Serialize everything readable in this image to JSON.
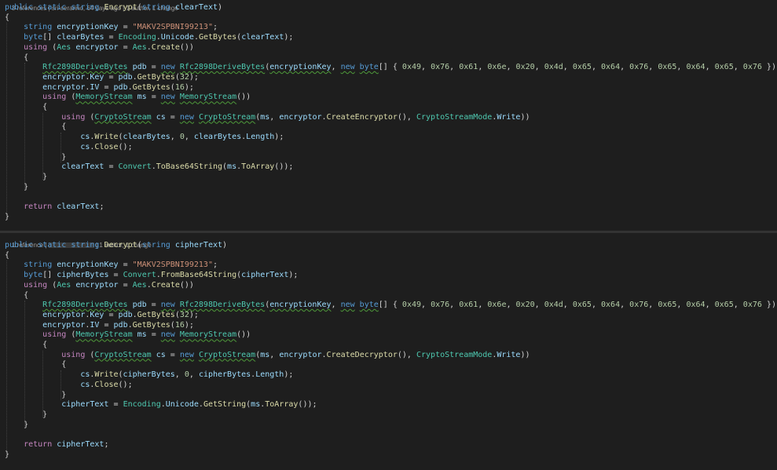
{
  "theme": {
    "background": "#1e1e1e",
    "keyword": "#569cd6",
    "type": "#4ec9b0",
    "method": "#dcdcaa",
    "variable": "#9cdcfe",
    "string": "#ce9178",
    "number": "#b5cea8",
    "control": "#c586c0",
    "plain": "#d4d4d4"
  },
  "code_lens": {
    "encrypt": "3 references | sri-serarino, 64 days ago | 1 author, 1 change",
    "decrypt_refs": "1 reference | ",
    "decrypt_meta": " | 1 author, 1 change"
  },
  "encrypt_block": [
    "public static string Encrypt(string clearText)",
    "{",
    "    string encryptionKey = \"MAKV2SPBNI99213\";",
    "    byte[] clearBytes = Encoding.Unicode.GetBytes(clearText);",
    "    using (Aes encryptor = Aes.Create())",
    "    {",
    "        Rfc2898DeriveBytes pdb = new Rfc2898DeriveBytes(encryptionKey, new byte[] { 0x49, 0x76, 0x61, 0x6e, 0x20, 0x4d, 0x65, 0x64, 0x76, 0x65, 0x64, 0x65, 0x76 });",
    "        encryptor.Key = pdb.GetBytes(32);",
    "        encryptor.IV = pdb.GetBytes(16);",
    "        using (MemoryStream ms = new MemoryStream())",
    "        {",
    "            using (CryptoStream cs = new CryptoStream(ms, encryptor.CreateEncryptor(), CryptoStreamMode.Write))",
    "            {",
    "                cs.Write(clearBytes, 0, clearBytes.Length);",
    "                cs.Close();",
    "            }",
    "            clearText = Convert.ToBase64String(ms.ToArray());",
    "        }",
    "    }",
    "",
    "    return clearText;",
    "}"
  ],
  "decrypt_block": [
    "public static string Decrypt(string cipherText)",
    "{",
    "    string encryptionKey = \"MAKV2SPBNI99213\";",
    "    byte[] cipherBytes = Convert.FromBase64String(cipherText);",
    "    using (Aes encryptor = Aes.Create())",
    "    {",
    "        Rfc2898DeriveBytes pdb = new Rfc2898DeriveBytes(encryptionKey, new byte[] { 0x49, 0x76, 0x61, 0x6e, 0x20, 0x4d, 0x65, 0x64, 0x76, 0x65, 0x64, 0x65, 0x76 });",
    "        encryptor.Key = pdb.GetBytes(32);",
    "        encryptor.IV = pdb.GetBytes(16);",
    "        using (MemoryStream ms = new MemoryStream())",
    "        {",
    "            using (CryptoStream cs = new CryptoStream(ms, encryptor.CreateDecryptor(), CryptoStreamMode.Write))",
    "            {",
    "                cs.Write(cipherBytes, 0, cipherBytes.Length);",
    "                cs.Close();",
    "            }",
    "            cipherText = Encoding.Unicode.GetString(ms.ToArray());",
    "        }",
    "    }",
    "",
    "    return cipherText;",
    "}"
  ]
}
